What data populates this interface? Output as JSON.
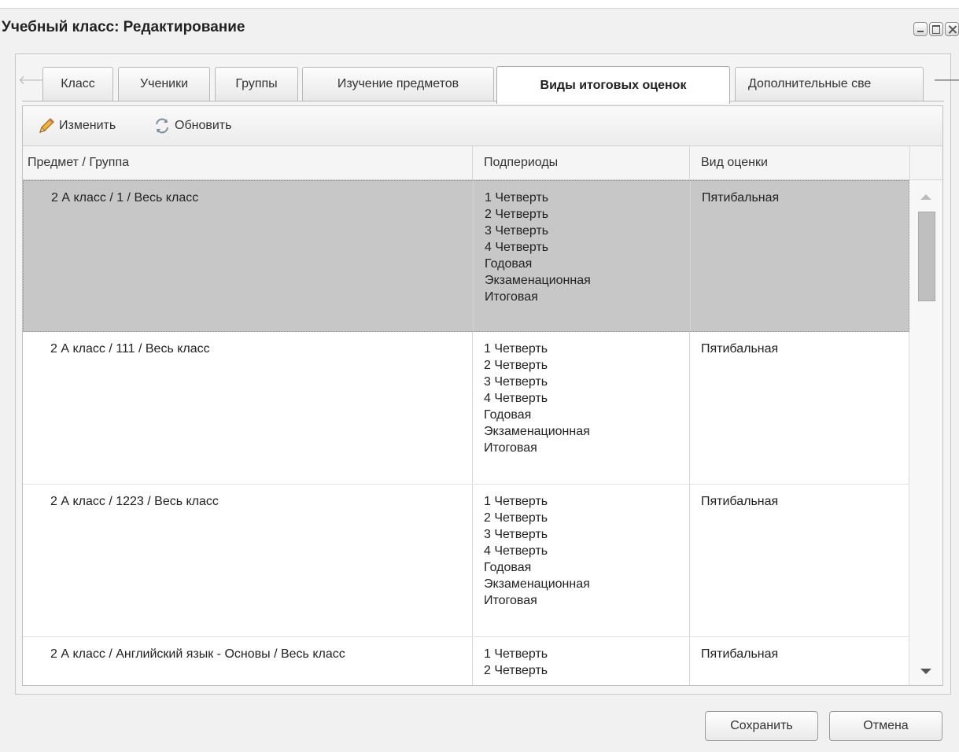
{
  "window": {
    "title": "Учебный класс: Редактирование"
  },
  "tabs": [
    {
      "label": "Класс",
      "active": false
    },
    {
      "label": "Ученики",
      "active": false
    },
    {
      "label": "Группы",
      "active": false
    },
    {
      "label": "Изучение предметов",
      "active": false
    },
    {
      "label": "Виды итоговых оценок",
      "active": true
    },
    {
      "label": "Дополнительные све",
      "active": false
    }
  ],
  "toolbar": {
    "edit_label": "Изменить",
    "refresh_label": "Обновить"
  },
  "table": {
    "columns": [
      "Предмет / Группа",
      "Подпериоды",
      "Вид оценки"
    ],
    "rows": [
      {
        "subject": "2 А класс / 1 / Весь класс",
        "periods": [
          "1 Четверть",
          "2 Четверть",
          "3 Четверть",
          "4 Четверть",
          "Годовая",
          "Экзаменационная",
          "Итоговая"
        ],
        "grade_type": "Пятибальная",
        "selected": true
      },
      {
        "subject": "2 А класс / 111 / Весь класс",
        "periods": [
          "1 Четверть",
          "2 Четверть",
          "3 Четверть",
          "4 Четверть",
          "Годовая",
          "Экзаменационная",
          "Итоговая"
        ],
        "grade_type": "Пятибальная",
        "selected": false
      },
      {
        "subject": "2 А класс / 1223 / Весь класс",
        "periods": [
          "1 Четверть",
          "2 Четверть",
          "3 Четверть",
          "4 Четверть",
          "Годовая",
          "Экзаменационная",
          "Итоговая"
        ],
        "grade_type": "Пятибальная",
        "selected": false
      },
      {
        "subject": "2 А класс / Английский язык - Основы / Весь класс",
        "periods": [
          "1 Четверть",
          "2 Четверть"
        ],
        "grade_type": "Пятибальная",
        "selected": false
      }
    ]
  },
  "footer": {
    "save_label": "Сохранить",
    "cancel_label": "Отмена"
  },
  "icons": {
    "edit": "pencil-icon",
    "refresh": "refresh-icon",
    "tab_left": "arrow-left-icon",
    "tab_right": "arrow-right-icon"
  }
}
